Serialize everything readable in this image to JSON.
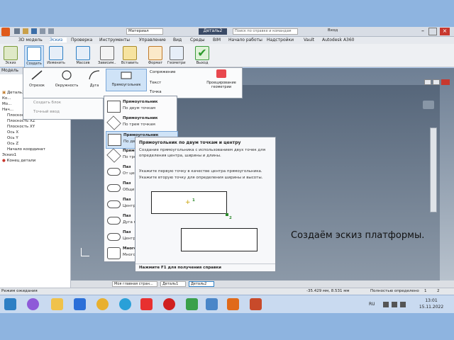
{
  "app": {
    "title": "Деталь2",
    "search_placeholder": "Поиск по справке и командам",
    "user": "Вход",
    "material": "Материал",
    "appearance": "Внешний вид"
  },
  "menu": [
    "ЗD модель",
    "Эскиз",
    "Проверка",
    "Инструменты",
    "Управление",
    "Вид",
    "Среды",
    "BIM",
    "Начало работы",
    "Надстройки",
    "Vault",
    "Autodesk A360"
  ],
  "ribbon": {
    "buttons": [
      "Эскиз",
      "Создать",
      "Изменить",
      "Массив",
      "Зависим...",
      "Вставить",
      "Формат",
      "Геометрия",
      "Выход"
    ],
    "accent": "#2d7fc4"
  },
  "sketch_panel": {
    "tools": [
      "Отрезок",
      "Окружность",
      "Дуга",
      "Прямоугольник"
    ],
    "create_block": "Создать блок",
    "point": "Точный ввод",
    "fillet": "Сопряжение",
    "text": "Текст",
    "point_tool": "Точка",
    "project": "Проецирование геометрии"
  },
  "rect_menu": {
    "items": [
      {
        "title": "Прямоугольник",
        "sub": "По двум точкам"
      },
      {
        "title": "Прямоугольник",
        "sub": "По трем точкам"
      },
      {
        "title": "Прямоугольник",
        "sub": "По двум точкам"
      },
      {
        "title": "Прямоуг",
        "sub": "По трем"
      },
      {
        "title": "Паз",
        "sub": "От цент"
      },
      {
        "title": "Паз",
        "sub": "Общий"
      },
      {
        "title": "Паз",
        "sub": "Центр"
      },
      {
        "title": "Паз",
        "sub": "Дуга по"
      },
      {
        "title": "Паз",
        "sub": "Центр д"
      },
      {
        "title": "Многоу",
        "sub": "Многоу"
      }
    ]
  },
  "tooltip": {
    "title": "Прямоугольник по двум точкам и центру",
    "desc": "Создание прямоугольника с использованием двух точек для определения центра, ширины и длины.",
    "hint1": "Укажите первую точку в качестве центра прямоугольника.",
    "hint2": "Укажите вторую точку для определения ширины и высоты.",
    "label1": "1",
    "label2": "2",
    "footer": "Нажмите F1 для получения справки"
  },
  "browser": {
    "header": "Модель",
    "items": [
      "Деталь2",
      "Ко...",
      "Мо...",
      "Нач...",
      "Плоскость YZ",
      "Плоскость XZ",
      "Плоскость XY",
      "Ось X",
      "Ось Y",
      "Ось Z",
      "Начало координат",
      "Эскиз1",
      "Конец детали"
    ]
  },
  "doc_tabs": [
    "Моя главная стран...",
    "Деталь1",
    "Деталь2"
  ],
  "status": {
    "left": "Режим ожидания",
    "coords": "-35.429 мм, 8.531 мм",
    "constraint": "Полностью определено",
    "n1": "1",
    "n2": "2"
  },
  "taskbar": {
    "lang": "RU",
    "time": "13:01",
    "date": "15.11.2022"
  },
  "caption": "Создаём эскиз платформы."
}
